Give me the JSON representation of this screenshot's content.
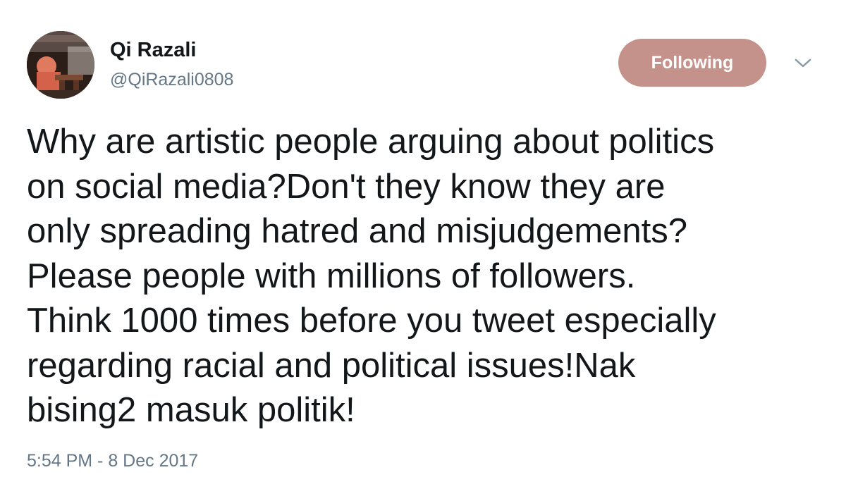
{
  "author": {
    "display_name": "Qi Razali",
    "handle": "@QiRazali0808"
  },
  "follow_button": {
    "label": "Following",
    "color": "#c4918b"
  },
  "menu_icon": "chevron-down-icon",
  "tweet": {
    "lines": [
      "Why are artistic people arguing about politics",
      "on social media?Don't they know they are",
      "only spreading hatred and misjudgements?",
      "Please people with millions of followers.",
      "Think 1000 times before you tweet especially",
      "regarding racial and political issues!Nak",
      "bising2 masuk politik!"
    ],
    "timestamp": "5:54 PM - 8 Dec 2017"
  },
  "colors": {
    "text": "#14171a",
    "secondary": "#657786"
  }
}
